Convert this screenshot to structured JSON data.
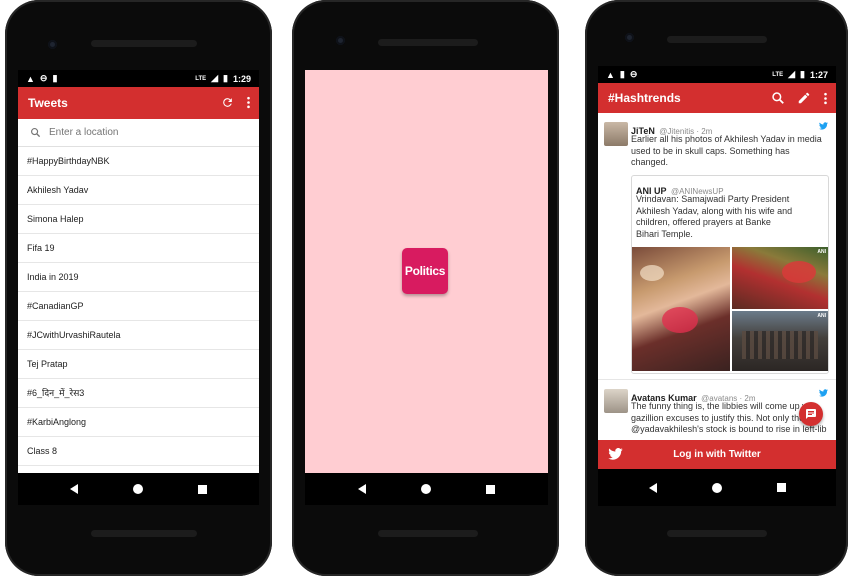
{
  "phone1": {
    "status": {
      "time": "1:29",
      "signal_label": "LTE"
    },
    "appbar": {
      "title": "Tweets",
      "refresh_icon": "refresh-icon",
      "menu_icon": "more-vert-icon"
    },
    "search": {
      "placeholder": "Enter a location"
    },
    "trends": [
      "#HappyBirthdayNBK",
      "Akhilesh Yadav",
      "Simona Halep",
      "Fifa 19",
      "India in 2019",
      "#CanadianGP",
      "#JCwithUrvashiRautela",
      "Tej Pratap",
      "#6_दिन_में_रेस3",
      "#KarbiAnglong",
      "Class 8"
    ]
  },
  "phone2": {
    "splash_color": "#ffcdd2",
    "logo_text": "Politics",
    "logo_color": "#d81b60"
  },
  "phone3": {
    "status": {
      "time": "1:27",
      "signal_label": "LTE"
    },
    "appbar": {
      "title": "#Hashtrends"
    },
    "tweet1": {
      "name": "JiTeN",
      "handle": "@Jitenitis · 2m",
      "text": "Earlier all his photos of Akhilesh Yadav in media used to be in skull caps. Something has changed.",
      "quote": {
        "name": "ANI UP",
        "handle": "@ANINewsUP",
        "text": "Vrindavan: Samajwadi Party President Akhilesh Yadav, along with his wife and children, offered prayers at Banke Bihari Temple.",
        "watermark": "ANI"
      }
    },
    "tweet2": {
      "name": "Avatans Kumar",
      "handle": "@avatans · 2m",
      "text": "The funny thing is, the libbies will come up with gazillion excuses to justify this. Not only the @yadavakhilesh's stock is bound to rise in left-lib"
    },
    "login": {
      "label": "Log in with Twitter"
    }
  },
  "colors": {
    "primary": "#d32f2f",
    "twitter_blue": "#1da1f2"
  }
}
